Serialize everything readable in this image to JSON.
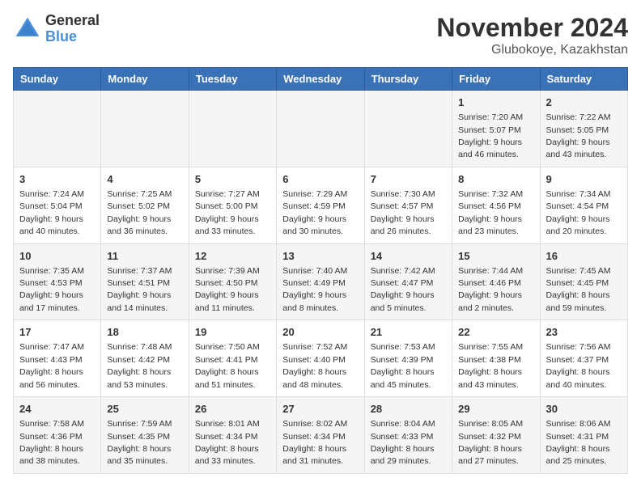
{
  "logo": {
    "text_general": "General",
    "text_blue": "Blue"
  },
  "title": "November 2024",
  "subtitle": "Glubokoye, Kazakhstan",
  "weekdays": [
    "Sunday",
    "Monday",
    "Tuesday",
    "Wednesday",
    "Thursday",
    "Friday",
    "Saturday"
  ],
  "weeks": [
    [
      {
        "day": "",
        "info": ""
      },
      {
        "day": "",
        "info": ""
      },
      {
        "day": "",
        "info": ""
      },
      {
        "day": "",
        "info": ""
      },
      {
        "day": "",
        "info": ""
      },
      {
        "day": "1",
        "info": "Sunrise: 7:20 AM\nSunset: 5:07 PM\nDaylight: 9 hours\nand 46 minutes."
      },
      {
        "day": "2",
        "info": "Sunrise: 7:22 AM\nSunset: 5:05 PM\nDaylight: 9 hours\nand 43 minutes."
      }
    ],
    [
      {
        "day": "3",
        "info": "Sunrise: 7:24 AM\nSunset: 5:04 PM\nDaylight: 9 hours\nand 40 minutes."
      },
      {
        "day": "4",
        "info": "Sunrise: 7:25 AM\nSunset: 5:02 PM\nDaylight: 9 hours\nand 36 minutes."
      },
      {
        "day": "5",
        "info": "Sunrise: 7:27 AM\nSunset: 5:00 PM\nDaylight: 9 hours\nand 33 minutes."
      },
      {
        "day": "6",
        "info": "Sunrise: 7:29 AM\nSunset: 4:59 PM\nDaylight: 9 hours\nand 30 minutes."
      },
      {
        "day": "7",
        "info": "Sunrise: 7:30 AM\nSunset: 4:57 PM\nDaylight: 9 hours\nand 26 minutes."
      },
      {
        "day": "8",
        "info": "Sunrise: 7:32 AM\nSunset: 4:56 PM\nDaylight: 9 hours\nand 23 minutes."
      },
      {
        "day": "9",
        "info": "Sunrise: 7:34 AM\nSunset: 4:54 PM\nDaylight: 9 hours\nand 20 minutes."
      }
    ],
    [
      {
        "day": "10",
        "info": "Sunrise: 7:35 AM\nSunset: 4:53 PM\nDaylight: 9 hours\nand 17 minutes."
      },
      {
        "day": "11",
        "info": "Sunrise: 7:37 AM\nSunset: 4:51 PM\nDaylight: 9 hours\nand 14 minutes."
      },
      {
        "day": "12",
        "info": "Sunrise: 7:39 AM\nSunset: 4:50 PM\nDaylight: 9 hours\nand 11 minutes."
      },
      {
        "day": "13",
        "info": "Sunrise: 7:40 AM\nSunset: 4:49 PM\nDaylight: 9 hours\nand 8 minutes."
      },
      {
        "day": "14",
        "info": "Sunrise: 7:42 AM\nSunset: 4:47 PM\nDaylight: 9 hours\nand 5 minutes."
      },
      {
        "day": "15",
        "info": "Sunrise: 7:44 AM\nSunset: 4:46 PM\nDaylight: 9 hours\nand 2 minutes."
      },
      {
        "day": "16",
        "info": "Sunrise: 7:45 AM\nSunset: 4:45 PM\nDaylight: 8 hours\nand 59 minutes."
      }
    ],
    [
      {
        "day": "17",
        "info": "Sunrise: 7:47 AM\nSunset: 4:43 PM\nDaylight: 8 hours\nand 56 minutes."
      },
      {
        "day": "18",
        "info": "Sunrise: 7:48 AM\nSunset: 4:42 PM\nDaylight: 8 hours\nand 53 minutes."
      },
      {
        "day": "19",
        "info": "Sunrise: 7:50 AM\nSunset: 4:41 PM\nDaylight: 8 hours\nand 51 minutes."
      },
      {
        "day": "20",
        "info": "Sunrise: 7:52 AM\nSunset: 4:40 PM\nDaylight: 8 hours\nand 48 minutes."
      },
      {
        "day": "21",
        "info": "Sunrise: 7:53 AM\nSunset: 4:39 PM\nDaylight: 8 hours\nand 45 minutes."
      },
      {
        "day": "22",
        "info": "Sunrise: 7:55 AM\nSunset: 4:38 PM\nDaylight: 8 hours\nand 43 minutes."
      },
      {
        "day": "23",
        "info": "Sunrise: 7:56 AM\nSunset: 4:37 PM\nDaylight: 8 hours\nand 40 minutes."
      }
    ],
    [
      {
        "day": "24",
        "info": "Sunrise: 7:58 AM\nSunset: 4:36 PM\nDaylight: 8 hours\nand 38 minutes."
      },
      {
        "day": "25",
        "info": "Sunrise: 7:59 AM\nSunset: 4:35 PM\nDaylight: 8 hours\nand 35 minutes."
      },
      {
        "day": "26",
        "info": "Sunrise: 8:01 AM\nSunset: 4:34 PM\nDaylight: 8 hours\nand 33 minutes."
      },
      {
        "day": "27",
        "info": "Sunrise: 8:02 AM\nSunset: 4:34 PM\nDaylight: 8 hours\nand 31 minutes."
      },
      {
        "day": "28",
        "info": "Sunrise: 8:04 AM\nSunset: 4:33 PM\nDaylight: 8 hours\nand 29 minutes."
      },
      {
        "day": "29",
        "info": "Sunrise: 8:05 AM\nSunset: 4:32 PM\nDaylight: 8 hours\nand 27 minutes."
      },
      {
        "day": "30",
        "info": "Sunrise: 8:06 AM\nSunset: 4:31 PM\nDaylight: 8 hours\nand 25 minutes."
      }
    ]
  ]
}
